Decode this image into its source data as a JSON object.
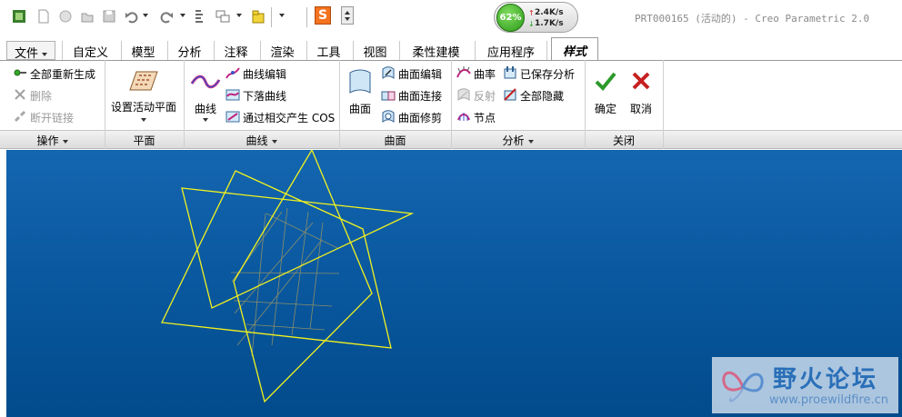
{
  "window": {
    "title": "PRT000165 (活动的) - Creo Parametric 2.0"
  },
  "quick_access": {
    "icons": [
      "new-icon",
      "open-icon",
      "save-icon",
      "undo-icon",
      "redo-icon",
      "regenerate-icon",
      "windows-icon",
      "close-window-icon"
    ],
    "s_logo": "S"
  },
  "net_monitor": {
    "percent": "62%",
    "upload": "2.4K/s",
    "download": "1.7K/s"
  },
  "tabs": [
    {
      "label": "文件"
    },
    {
      "label": "自定义"
    },
    {
      "label": "模型"
    },
    {
      "label": "分析"
    },
    {
      "label": "注释"
    },
    {
      "label": "渲染"
    },
    {
      "label": "工具"
    },
    {
      "label": "视图"
    },
    {
      "label": "柔性建模"
    },
    {
      "label": "应用程序"
    },
    {
      "label": "样式"
    }
  ],
  "active_tab": "样式",
  "ribbon": {
    "operations": {
      "label": "操作",
      "items": [
        {
          "label": "全部重新生成",
          "enabled": true
        },
        {
          "label": "删除",
          "enabled": false
        },
        {
          "label": "断开链接",
          "enabled": false
        }
      ]
    },
    "plane": {
      "label": "平面",
      "set_active_plane": "设置活动平面"
    },
    "curves": {
      "label": "曲线",
      "curve": "曲线",
      "items": [
        {
          "label": "曲线编辑"
        },
        {
          "label": "下落曲线"
        },
        {
          "label": "通过相交产生 COS"
        }
      ]
    },
    "surfaces": {
      "label": "曲面",
      "surface": "曲面",
      "items": [
        {
          "label": "曲面编辑"
        },
        {
          "label": "曲面连接"
        },
        {
          "label": "曲面修剪"
        }
      ]
    },
    "analysis": {
      "label": "分析",
      "items": [
        {
          "label": "曲率",
          "enabled": true
        },
        {
          "label": "反射",
          "enabled": false
        },
        {
          "label": "节点",
          "enabled": true
        },
        {
          "label": "已保存分析",
          "enabled": true
        },
        {
          "label": "全部隐藏",
          "enabled": true
        }
      ]
    },
    "close": {
      "label": "关闭",
      "ok": "确定",
      "cancel": "取消"
    }
  },
  "colors": {
    "viewport_top": "#1466b0",
    "viewport_bottom": "#024b8c",
    "wireframe": "#f2f21e",
    "grid": "#8a8f6a",
    "ok": "#2c9a2a",
    "cancel": "#c62020"
  },
  "watermark": {
    "name": "野火论坛",
    "url": "www.proewildfire.cn"
  }
}
